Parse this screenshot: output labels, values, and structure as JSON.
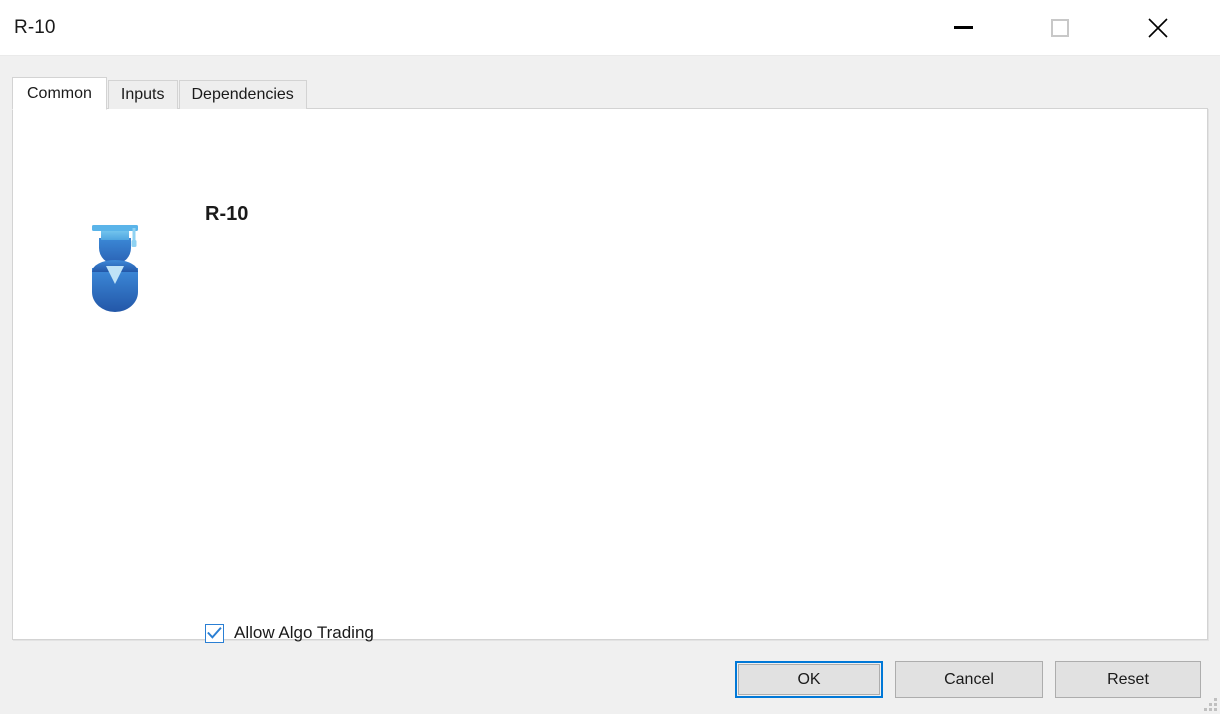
{
  "window": {
    "title": "R-10",
    "controls": {
      "minimize": {
        "name": "minimize-button",
        "glyph": "minimize-icon"
      },
      "maximize": {
        "name": "maximize-button",
        "glyph": "maximize-icon"
      },
      "close": {
        "name": "close-button",
        "glyph": "close-icon"
      }
    }
  },
  "tabs": [
    {
      "label": "Common",
      "active": true
    },
    {
      "label": "Inputs",
      "active": false
    },
    {
      "label": "Dependencies",
      "active": false
    }
  ],
  "common_tab": {
    "icon_name": "expert-advisor-graduate-icon",
    "expert_name": "R-10",
    "checkbox": {
      "label": "Allow Algo Trading",
      "checked": true
    }
  },
  "buttons": {
    "ok": "OK",
    "cancel": "Cancel",
    "reset": "Reset"
  },
  "colors": {
    "accent_blue": "#0078d7",
    "checkbox_blue": "#2a7fd4",
    "dialog_bg": "#f0f0f0",
    "panel_bg": "#ffffff",
    "button_bg": "#e1e1e1",
    "button_border": "#adadad",
    "tab_inactive_bg": "#eeeeee",
    "border": "#d3d3d3",
    "text": "#1a1a1a",
    "icon_cap_light": "#57b4e8",
    "icon_cap_dark": "#2d74c4",
    "icon_body": "#2c6fc0",
    "icon_collar": "#bfe3f7"
  }
}
